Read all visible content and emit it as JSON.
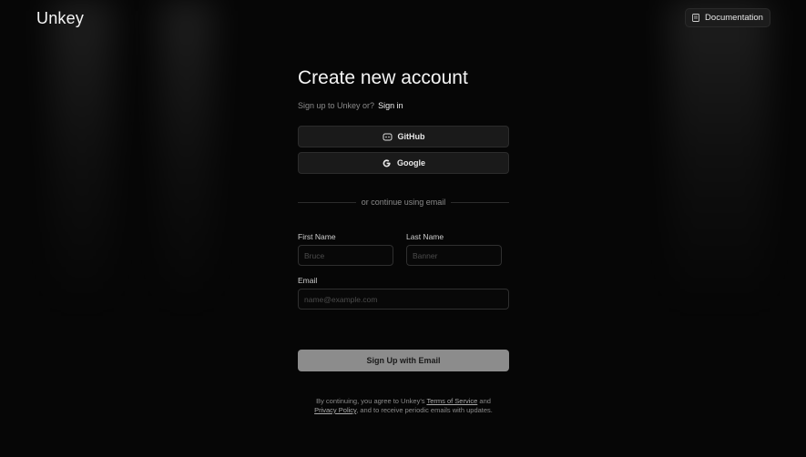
{
  "header": {
    "logo": "Unkey",
    "documentation_label": "Documentation"
  },
  "form": {
    "title": "Create new account",
    "subtitle_prefix": "Sign up to Unkey or?",
    "signin_link": "Sign in",
    "github_label": "GitHub",
    "google_label": "Google",
    "divider_text": "or continue using email",
    "first_name": {
      "label": "First Name",
      "placeholder": "Bruce"
    },
    "last_name": {
      "label": "Last Name",
      "placeholder": "Banner"
    },
    "email": {
      "label": "Email",
      "placeholder": "name@example.com"
    },
    "submit_label": "Sign Up with Email"
  },
  "terms": {
    "prefix": "By continuing, you agree to Unkey's",
    "terms_link": "Terms of Service",
    "and": "and",
    "privacy_link": "Privacy Policy",
    "suffix": ", and to receive periodic emails with updates."
  },
  "icons": {
    "documentation": "book-icon",
    "github": "github-icon",
    "google": "google-icon"
  },
  "colors": {
    "background": "#060606",
    "button_surface": "#1a1a1a",
    "submit_button": "#8c8c8c",
    "muted_text": "#8a8a8a"
  }
}
